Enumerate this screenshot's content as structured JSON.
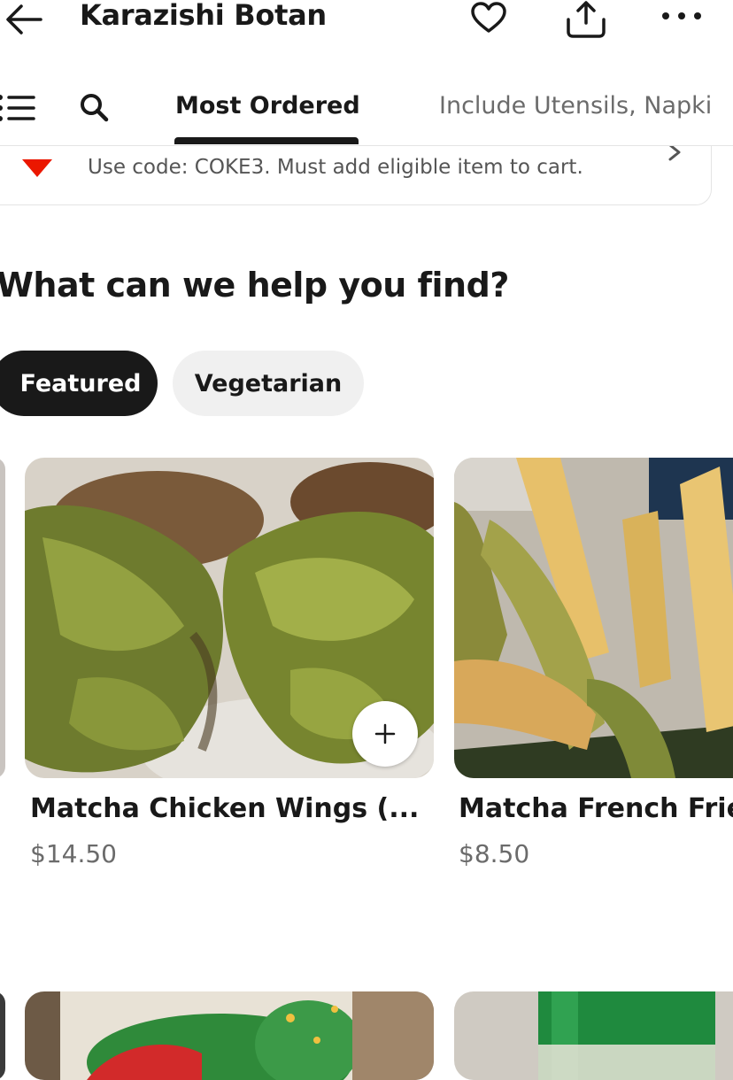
{
  "header": {
    "title": "Karazishi Botan",
    "icons": [
      "back-arrow-icon",
      "heart-icon",
      "share-icon",
      "more-icon"
    ]
  },
  "nav": {
    "icons": [
      "menu-icon",
      "search-icon"
    ],
    "tabs": [
      {
        "label": "Most Ordered",
        "active": true
      },
      {
        "label": "Include Utensils, Napki",
        "active": false
      }
    ]
  },
  "promo": {
    "text": "Use code: COKE3. Must add eligible item to cart."
  },
  "section": {
    "title": "What can we help you find?"
  },
  "filters": [
    {
      "label": "Featured",
      "selected": true
    },
    {
      "label": "Vegetarian",
      "selected": false
    }
  ],
  "items": [
    {
      "name": "Matcha Chicken Wings (...",
      "price": "$14.50"
    },
    {
      "name": "Matcha French Frie",
      "price": "$8.50"
    }
  ],
  "colors": {
    "accent_red": "#eb1700",
    "text_dark": "#191919",
    "text_muted": "#6b6b6b",
    "chip_bg": "#f0f0f0"
  }
}
